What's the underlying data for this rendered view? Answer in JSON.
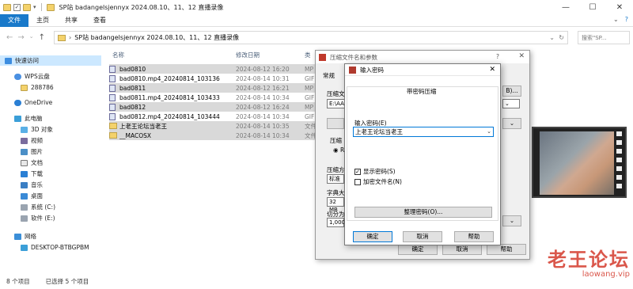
{
  "window": {
    "title": "SP站 badangelsjennyx 2024.08.10、11、12 直播录像"
  },
  "ribbon": {
    "tabs": [
      "文件",
      "主页",
      "共享",
      "查看"
    ]
  },
  "address": {
    "path": "SP站 badangelsjennyx 2024.08.10、11、12 直播录像",
    "search_placeholder": "搜索\"SP..."
  },
  "sidebar": {
    "items": [
      {
        "label": "快速访问",
        "icon": "star-icon"
      },
      {
        "label": "WPS云盘",
        "icon": "cloud-icon"
      },
      {
        "label": "288786",
        "icon": "folder-icon"
      },
      {
        "label": "OneDrive",
        "icon": "cloud-icon"
      },
      {
        "label": "此电脑",
        "icon": "computer-icon"
      },
      {
        "label": "3D 对象",
        "icon": "cube-icon"
      },
      {
        "label": "视频",
        "icon": "video-icon"
      },
      {
        "label": "图片",
        "icon": "picture-icon"
      },
      {
        "label": "文档",
        "icon": "document-icon"
      },
      {
        "label": "下载",
        "icon": "download-icon"
      },
      {
        "label": "音乐",
        "icon": "music-icon"
      },
      {
        "label": "桌面",
        "icon": "desktop-icon"
      },
      {
        "label": "系统 (C:)",
        "icon": "drive-icon"
      },
      {
        "label": "软件 (E:)",
        "icon": "drive-icon"
      },
      {
        "label": "网络",
        "icon": "network-icon"
      },
      {
        "label": "DESKTOP-BTBGPBM",
        "icon": "computer-icon"
      }
    ]
  },
  "columns": {
    "name": "名称",
    "date": "修改日期",
    "type": "类"
  },
  "files": [
    {
      "name": "bad0810",
      "date": "2024-08-12 16:20",
      "type": "MP"
    },
    {
      "name": "bad0810.mp4_20240814_103136",
      "date": "2024-08-14 10:31",
      "type": "GIF"
    },
    {
      "name": "bad0811",
      "date": "2024-08-12 16:21",
      "type": "MP"
    },
    {
      "name": "bad0811.mp4_20240814_103433",
      "date": "2024-08-14 10:34",
      "type": "GIF"
    },
    {
      "name": "bad0812",
      "date": "2024-08-12 16:24",
      "type": "MP"
    },
    {
      "name": "bad0812.mp4_20240814_103444",
      "date": "2024-08-14 10:34",
      "type": "GIF"
    },
    {
      "name": "上老王论坛当老王",
      "date": "2024-08-14 10:35",
      "type": "文件"
    },
    {
      "name": "__MACOSX",
      "date": "2024-08-14 10:34",
      "type": "文件"
    }
  ],
  "status": {
    "count": "8 个项目",
    "selected": "已选择 5 个项目"
  },
  "archive_dialog": {
    "title": "压缩文件名和参数",
    "help": "?",
    "tab_general": "常规",
    "label_archive": "压缩文",
    "path": "E:\\AAA",
    "browse": "B)...",
    "label_format": "压缩",
    "format_opt": "RA",
    "label_method": "压缩方",
    "method_val": "标准",
    "label_dict": "字典大",
    "dict_val": "32 MB",
    "label_split": "切分为",
    "split_val": "1,000",
    "ok": "确定",
    "cancel": "取消",
    "helpbtn": "帮助"
  },
  "password_dialog": {
    "title": "输入密码",
    "header": "带密码压缩",
    "label_password": "输入密码(E)",
    "password_value": "上老王论坛当老王",
    "show_password": "显示密码(S)",
    "encrypt_names": "加密文件名(N)",
    "show_password_checked": "✓",
    "manage": "整理密码(O)...",
    "ok": "确定",
    "cancel": "取消",
    "help": "帮助"
  },
  "watermark": {
    "title": "老王论坛",
    "url": "laowang.vip"
  },
  "colors": {
    "accent": "#1979ca",
    "selection": "#cce8ff"
  }
}
